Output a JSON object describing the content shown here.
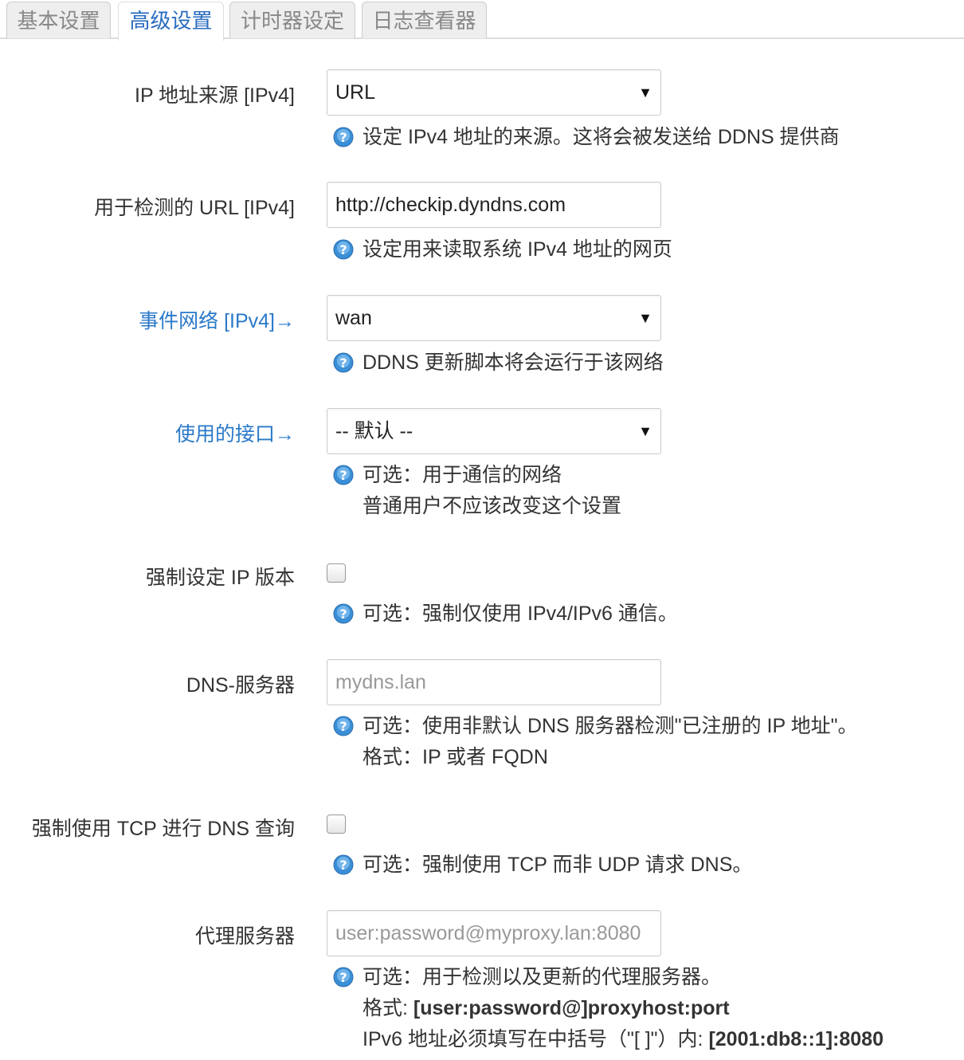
{
  "tabs": [
    {
      "label": "基本设置",
      "active": false
    },
    {
      "label": "高级设置",
      "active": true
    },
    {
      "label": "计时器设定",
      "active": false
    },
    {
      "label": "日志查看器",
      "active": false
    }
  ],
  "fields": {
    "ip_source": {
      "label": "IP 地址来源 [IPv4]",
      "value": "URL",
      "help": "设定 IPv4 地址的来源。这将会被发送给 DDNS 提供商"
    },
    "check_url": {
      "label": "用于检测的 URL [IPv4]",
      "value": "http://checkip.dyndns.com",
      "help": "设定用来读取系统 IPv4 地址的网页"
    },
    "event_network": {
      "label": "事件网络 [IPv4]→",
      "value": "wan",
      "help": "DDNS 更新脚本将会运行于该网络"
    },
    "interface": {
      "label": "使用的接口→",
      "value": "-- 默认 --",
      "help_line1": "可选：用于通信的网络",
      "help_line2": "普通用户不应该改变这个设置"
    },
    "force_ip_version": {
      "label": "强制设定 IP 版本",
      "checked": false,
      "help": "可选：强制仅使用 IPv4/IPv6 通信。"
    },
    "dns_server": {
      "label": "DNS-服务器",
      "placeholder": "mydns.lan",
      "help_line1": "可选：使用非默认 DNS 服务器检测\"已注册的 IP 地址\"。",
      "help_line2": "格式：IP 或者 FQDN"
    },
    "force_tcp": {
      "label": "强制使用 TCP 进行 DNS 查询",
      "checked": false,
      "help": "可选：强制使用 TCP 而非 UDP 请求 DNS。"
    },
    "proxy": {
      "label": "代理服务器",
      "placeholder": "user:password@myproxy.lan:8080",
      "help_line1": "可选：用于检测以及更新的代理服务器。",
      "help_line2_prefix": "格式: ",
      "help_line2_bold": "[user:password@]proxyhost:port",
      "help_line3_prefix": "IPv6 地址必须填写在中括号（\"[ ]\"）内: ",
      "help_line3_bold": "[2001:db8::1]:8080"
    }
  },
  "icons": {
    "help": "help-icon",
    "select_arrow": "▼"
  },
  "colors": {
    "active_tab": "#2a6cbf",
    "link_label": "#2a79c9",
    "help_icon": "#3a8fd6"
  }
}
